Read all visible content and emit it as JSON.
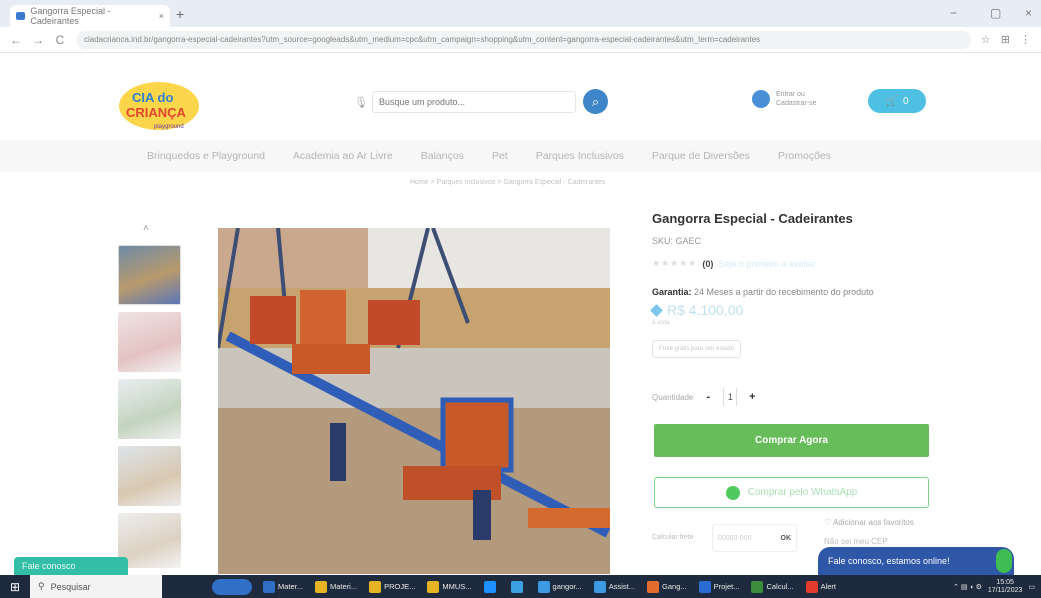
{
  "browser": {
    "tab_title": "Gangorra Especial - Cadeirantes",
    "tab_close": "×",
    "new_tab": "+",
    "minimize": "−",
    "restore": "▢",
    "close": "×",
    "back": "←",
    "forward": "→",
    "reload": "C",
    "url": "ciadacrianca.ind.br/gangorra-especial-cadeirantes?utm_source=googleads&utm_medium=cpc&utm_campaign=shopping&utm_content=gangorra-especial-cadeirantes&utm_term=cadeirantes"
  },
  "header": {
    "logo_text_line1": "CIA do",
    "logo_text_line2": "CRIANÇA",
    "logo_tagline": "playground",
    "search_placeholder": "Busque um produto...",
    "account_line1": "Entrar ou",
    "account_line2": "Cadastrar-se",
    "cart_count": "0"
  },
  "nav": {
    "items": [
      "Brinquedos e Playground",
      "Academia ao Ar Livre",
      "Balanços",
      "Pet",
      "Parques Inclusivos",
      "Parque de Diversões",
      "Promoções"
    ]
  },
  "breadcrumb": "Home > Parques Inclusivos > Gangorra Especial - Cadeirantes",
  "product": {
    "title": "Gangorra Especial - Cadeirantes",
    "sku": "SKU: GAEC",
    "stars": "★★★★★",
    "review_count": "(0)",
    "review_link": "Seja o primeiro a avaliar",
    "warranty_label": "Garantia:",
    "warranty_text": "24 Meses a partir do recebimento do produto",
    "price": "R$ 4.100,00",
    "price_note": "à vista",
    "shipping_tag": "Frete grátis para seu estado",
    "qty_label": "Quantidade",
    "qty_minus": "-",
    "qty_value": "1",
    "qty_plus": "+",
    "buy_label": "Comprar Agora",
    "whatsapp_label": "Comprar pelo WhatsApp",
    "ship_label": "Calcular frete",
    "cep_placeholder": "00000-000",
    "cep_ok": "OK",
    "favorites": "Adicionar aos favoritos",
    "tail_text": "Não sei meu CEP"
  },
  "chat": {
    "left_label": "Fale conosco",
    "right_label": "Fale conosco, estamos online!"
  },
  "taskbar": {
    "search": "Pesquisar",
    "apps": [
      {
        "label": "Mater...",
        "color": "#2f6fc6"
      },
      {
        "label": "Materi...",
        "color": "#e6b422"
      },
      {
        "label": "PROJE...",
        "color": "#e6b422"
      },
      {
        "label": "MMUS...",
        "color": "#e6b422"
      },
      {
        "label": "",
        "color": "#1e90ff"
      },
      {
        "label": "",
        "color": "#3aa0e0"
      },
      {
        "label": "gangor...",
        "color": "#3a9be0"
      },
      {
        "label": "Assist...",
        "color": "#3a9be0"
      },
      {
        "label": "Gang...",
        "color": "#e36b2c"
      },
      {
        "label": "Projet...",
        "color": "#2b6cd4"
      },
      {
        "label": "Calcul...",
        "color": "#3b8d3b"
      },
      {
        "label": "Alert",
        "color": "#e23b2e"
      }
    ],
    "time": "15:05",
    "date": "17/11/2023"
  }
}
